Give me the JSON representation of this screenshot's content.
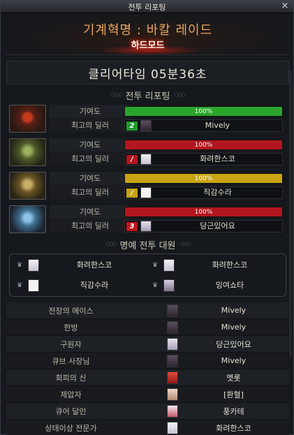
{
  "window": {
    "title": "전투 리포팅",
    "close_label": "×"
  },
  "banner": {
    "title": "기계혁명 : 바칼 레이드",
    "difficulty": "하드모드"
  },
  "clear_time": "클리어타임 05분36초",
  "sections": {
    "report": "전투 리포팅",
    "honor": "명예 전투 대원"
  },
  "bosses": [
    {
      "contribution_label": "기여도",
      "top_dealer_label": "최고의 딜러",
      "contribution_percent": 100,
      "contribution_text": "100%",
      "bar_color": "#2aa52a",
      "rank_text": "2",
      "rank_color": "#1e9b2a",
      "dealer": "Mively",
      "portrait_icon": "red-dragon-boss-icon"
    },
    {
      "contribution_label": "기여도",
      "top_dealer_label": "최고의 딜러",
      "contribution_percent": 100,
      "contribution_text": "100%",
      "bar_color": "#b2161e",
      "rank_text": "/",
      "rank_color": "#b2161e",
      "dealer": "화려한스코",
      "portrait_icon": "green-dragon-boss-icon"
    },
    {
      "contribution_label": "기여도",
      "top_dealer_label": "최고의 딜러",
      "contribution_percent": 100,
      "contribution_text": "100%",
      "bar_color": "#c8a414",
      "rank_text": "/",
      "rank_color": "#c8a414",
      "dealer": "직감수라",
      "portrait_icon": "gold-dragon-boss-icon"
    },
    {
      "contribution_label": "기여도",
      "top_dealer_label": "최고의 딜러",
      "contribution_percent": 100,
      "contribution_text": "100%",
      "bar_color": "#b2161e",
      "rank_text": "3",
      "rank_color": "#c0141c",
      "dealer": "당근있어요",
      "portrait_icon": "blue-dragon-boss-icon"
    }
  ],
  "honor_members": [
    "화려한스코",
    "화려한스코",
    "직감수라",
    "잉여쇼타"
  ],
  "awards": [
    {
      "title": "전장의 에이스",
      "player": "Mively"
    },
    {
      "title": "한방",
      "player": "Mively"
    },
    {
      "title": "구원자",
      "player": "당근있어요"
    },
    {
      "title": "큐브 사장님",
      "player": "Mively"
    },
    {
      "title": "회피의 신",
      "player": "멧롯"
    },
    {
      "title": "제압자",
      "player": "[환혈]"
    },
    {
      "title": "큐어 달인",
      "player": "풍카테"
    },
    {
      "title": "상태이상 전문가",
      "player": "화려한스코"
    }
  ]
}
